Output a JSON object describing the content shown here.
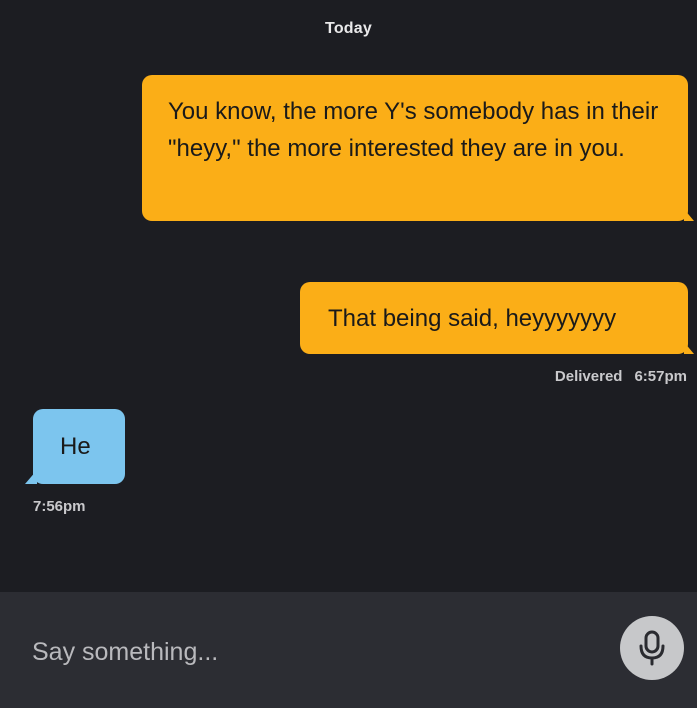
{
  "conversation": {
    "day_label": "Today"
  },
  "messages": [
    {
      "direction": "outgoing",
      "text": "You know, the more Y's somebody has in their \"heyy,\" the more interested they are in you."
    },
    {
      "direction": "outgoing",
      "text": "That being said, heyyyyyyy",
      "status": "Delivered",
      "time": "6:57pm"
    },
    {
      "direction": "incoming",
      "text": "He",
      "time": "7:56pm"
    }
  ],
  "composer": {
    "placeholder": "Say something...",
    "mic_icon": "microphone-icon"
  },
  "colors": {
    "background": "#1c1d22",
    "outgoing_bubble": "#fbae17",
    "incoming_bubble": "#7cc5ee",
    "composer_bar": "#2c2d33",
    "mic_button": "#c7c8ca"
  }
}
